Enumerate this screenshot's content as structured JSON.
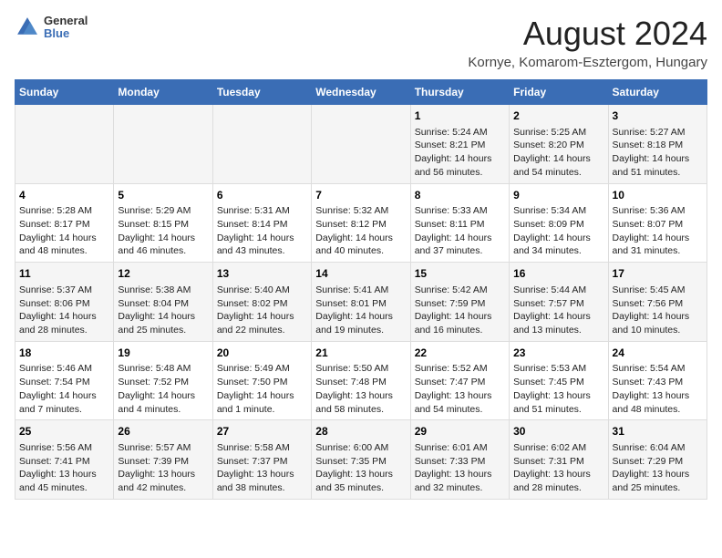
{
  "header": {
    "logo": {
      "line1": "General",
      "line2": "Blue"
    },
    "title": "August 2024",
    "subtitle": "Kornye, Komarom-Esztergom, Hungary"
  },
  "days_of_week": [
    "Sunday",
    "Monday",
    "Tuesday",
    "Wednesday",
    "Thursday",
    "Friday",
    "Saturday"
  ],
  "weeks": [
    [
      {
        "day": "",
        "content": ""
      },
      {
        "day": "",
        "content": ""
      },
      {
        "day": "",
        "content": ""
      },
      {
        "day": "",
        "content": ""
      },
      {
        "day": "1",
        "content": "Sunrise: 5:24 AM\nSunset: 8:21 PM\nDaylight: 14 hours\nand 56 minutes."
      },
      {
        "day": "2",
        "content": "Sunrise: 5:25 AM\nSunset: 8:20 PM\nDaylight: 14 hours\nand 54 minutes."
      },
      {
        "day": "3",
        "content": "Sunrise: 5:27 AM\nSunset: 8:18 PM\nDaylight: 14 hours\nand 51 minutes."
      }
    ],
    [
      {
        "day": "4",
        "content": "Sunrise: 5:28 AM\nSunset: 8:17 PM\nDaylight: 14 hours\nand 48 minutes."
      },
      {
        "day": "5",
        "content": "Sunrise: 5:29 AM\nSunset: 8:15 PM\nDaylight: 14 hours\nand 46 minutes."
      },
      {
        "day": "6",
        "content": "Sunrise: 5:31 AM\nSunset: 8:14 PM\nDaylight: 14 hours\nand 43 minutes."
      },
      {
        "day": "7",
        "content": "Sunrise: 5:32 AM\nSunset: 8:12 PM\nDaylight: 14 hours\nand 40 minutes."
      },
      {
        "day": "8",
        "content": "Sunrise: 5:33 AM\nSunset: 8:11 PM\nDaylight: 14 hours\nand 37 minutes."
      },
      {
        "day": "9",
        "content": "Sunrise: 5:34 AM\nSunset: 8:09 PM\nDaylight: 14 hours\nand 34 minutes."
      },
      {
        "day": "10",
        "content": "Sunrise: 5:36 AM\nSunset: 8:07 PM\nDaylight: 14 hours\nand 31 minutes."
      }
    ],
    [
      {
        "day": "11",
        "content": "Sunrise: 5:37 AM\nSunset: 8:06 PM\nDaylight: 14 hours\nand 28 minutes."
      },
      {
        "day": "12",
        "content": "Sunrise: 5:38 AM\nSunset: 8:04 PM\nDaylight: 14 hours\nand 25 minutes."
      },
      {
        "day": "13",
        "content": "Sunrise: 5:40 AM\nSunset: 8:02 PM\nDaylight: 14 hours\nand 22 minutes."
      },
      {
        "day": "14",
        "content": "Sunrise: 5:41 AM\nSunset: 8:01 PM\nDaylight: 14 hours\nand 19 minutes."
      },
      {
        "day": "15",
        "content": "Sunrise: 5:42 AM\nSunset: 7:59 PM\nDaylight: 14 hours\nand 16 minutes."
      },
      {
        "day": "16",
        "content": "Sunrise: 5:44 AM\nSunset: 7:57 PM\nDaylight: 14 hours\nand 13 minutes."
      },
      {
        "day": "17",
        "content": "Sunrise: 5:45 AM\nSunset: 7:56 PM\nDaylight: 14 hours\nand 10 minutes."
      }
    ],
    [
      {
        "day": "18",
        "content": "Sunrise: 5:46 AM\nSunset: 7:54 PM\nDaylight: 14 hours\nand 7 minutes."
      },
      {
        "day": "19",
        "content": "Sunrise: 5:48 AM\nSunset: 7:52 PM\nDaylight: 14 hours\nand 4 minutes."
      },
      {
        "day": "20",
        "content": "Sunrise: 5:49 AM\nSunset: 7:50 PM\nDaylight: 14 hours\nand 1 minute."
      },
      {
        "day": "21",
        "content": "Sunrise: 5:50 AM\nSunset: 7:48 PM\nDaylight: 13 hours\nand 58 minutes."
      },
      {
        "day": "22",
        "content": "Sunrise: 5:52 AM\nSunset: 7:47 PM\nDaylight: 13 hours\nand 54 minutes."
      },
      {
        "day": "23",
        "content": "Sunrise: 5:53 AM\nSunset: 7:45 PM\nDaylight: 13 hours\nand 51 minutes."
      },
      {
        "day": "24",
        "content": "Sunrise: 5:54 AM\nSunset: 7:43 PM\nDaylight: 13 hours\nand 48 minutes."
      }
    ],
    [
      {
        "day": "25",
        "content": "Sunrise: 5:56 AM\nSunset: 7:41 PM\nDaylight: 13 hours\nand 45 minutes."
      },
      {
        "day": "26",
        "content": "Sunrise: 5:57 AM\nSunset: 7:39 PM\nDaylight: 13 hours\nand 42 minutes."
      },
      {
        "day": "27",
        "content": "Sunrise: 5:58 AM\nSunset: 7:37 PM\nDaylight: 13 hours\nand 38 minutes."
      },
      {
        "day": "28",
        "content": "Sunrise: 6:00 AM\nSunset: 7:35 PM\nDaylight: 13 hours\nand 35 minutes."
      },
      {
        "day": "29",
        "content": "Sunrise: 6:01 AM\nSunset: 7:33 PM\nDaylight: 13 hours\nand 32 minutes."
      },
      {
        "day": "30",
        "content": "Sunrise: 6:02 AM\nSunset: 7:31 PM\nDaylight: 13 hours\nand 28 minutes."
      },
      {
        "day": "31",
        "content": "Sunrise: 6:04 AM\nSunset: 7:29 PM\nDaylight: 13 hours\nand 25 minutes."
      }
    ]
  ]
}
